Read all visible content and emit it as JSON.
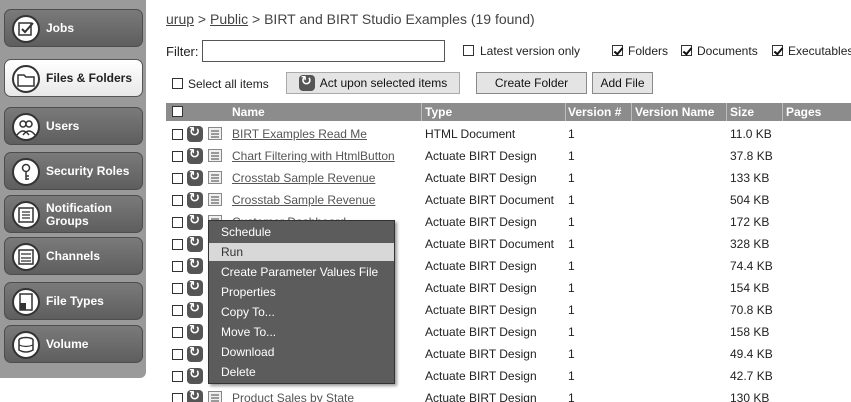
{
  "sidebar": {
    "items": [
      {
        "label": "Jobs",
        "icon": "jobs-icon",
        "active": false
      },
      {
        "label": "Files & Folders",
        "icon": "folder-icon",
        "active": true
      },
      {
        "label": "Users",
        "icon": "users-icon",
        "active": false
      },
      {
        "label": "Security Roles",
        "icon": "key-icon",
        "active": false
      },
      {
        "label": "Notification",
        "label2": "Groups",
        "icon": "notification-icon",
        "active": false
      },
      {
        "label": "Channels",
        "icon": "channels-icon",
        "active": false
      },
      {
        "label": "File Types",
        "icon": "file-types-icon",
        "active": false
      },
      {
        "label": "Volume",
        "icon": "volume-icon",
        "active": false
      }
    ]
  },
  "breadcrumb": {
    "part1": "urup",
    "sep1": " > ",
    "part2": "Public",
    "rest": " > BIRT and BIRT Studio Examples  (19 found)"
  },
  "filter": {
    "label": "Filter:",
    "value": "",
    "latest_label": "Latest version only",
    "latest_checked": false,
    "folders_label": "Folders",
    "folders_checked": true,
    "documents_label": "Documents",
    "documents_checked": true,
    "executables_label": "Executables",
    "executables_checked": true
  },
  "actions": {
    "select_all_label": "Select all items",
    "act_upon_label": "Act upon selected items",
    "create_folder_label": "Create Folder",
    "add_file_label": "Add File"
  },
  "table": {
    "headers": {
      "name": "Name",
      "type": "Type",
      "version": "Version #",
      "version_name": "Version Name",
      "size": "Size",
      "pages": "Pages"
    },
    "rows": [
      {
        "name": "BIRT Examples Read Me",
        "type": "HTML Document",
        "version": "1",
        "size": "11.0 KB"
      },
      {
        "name": "Chart Filtering with HtmlButton",
        "type": "Actuate BIRT Design",
        "version": "1",
        "size": "37.8 KB"
      },
      {
        "name": "Crosstab Sample Revenue",
        "type": "Actuate BIRT Design",
        "version": "1",
        "size": "133 KB"
      },
      {
        "name": "Crosstab Sample Revenue",
        "type": "Actuate BIRT Document",
        "version": "1",
        "size": "504 KB"
      },
      {
        "name": "Customer Dashboard",
        "type": "Actuate BIRT Design",
        "version": "1",
        "size": "172 KB"
      },
      {
        "name": "",
        "type": "Actuate BIRT Document",
        "version": "1",
        "size": "328 KB"
      },
      {
        "name": "",
        "type": "Actuate BIRT Design",
        "version": "1",
        "size": "74.4 KB"
      },
      {
        "name": "",
        "type": "Actuate BIRT Design",
        "version": "1",
        "size": "154 KB"
      },
      {
        "name": "",
        "type": "Actuate BIRT Design",
        "version": "1",
        "size": "70.8 KB"
      },
      {
        "name": "",
        "type": "Actuate BIRT Design",
        "version": "1",
        "size": "158 KB"
      },
      {
        "name": "",
        "type": "Actuate BIRT Design",
        "version": "1",
        "size": "49.4 KB"
      },
      {
        "name": "",
        "type": "Actuate BIRT Design",
        "version": "1",
        "size": "42.7 KB"
      },
      {
        "name": "Product Sales by State",
        "type": "Actuate BIRT Design",
        "version": "1",
        "size": "130 KB"
      }
    ]
  },
  "context_menu": {
    "items": [
      "Schedule",
      "Run",
      "Create Parameter Values File",
      "Properties",
      "Copy To...",
      "Move To...",
      "Download",
      "Delete"
    ],
    "hovered": "Run"
  },
  "colors": {
    "sidebar_bg": "#9a9a9a",
    "header_bg": "#8c8c8c",
    "menu_bg": "#5c5c5c",
    "menu_hover": "#d8d8d8"
  }
}
